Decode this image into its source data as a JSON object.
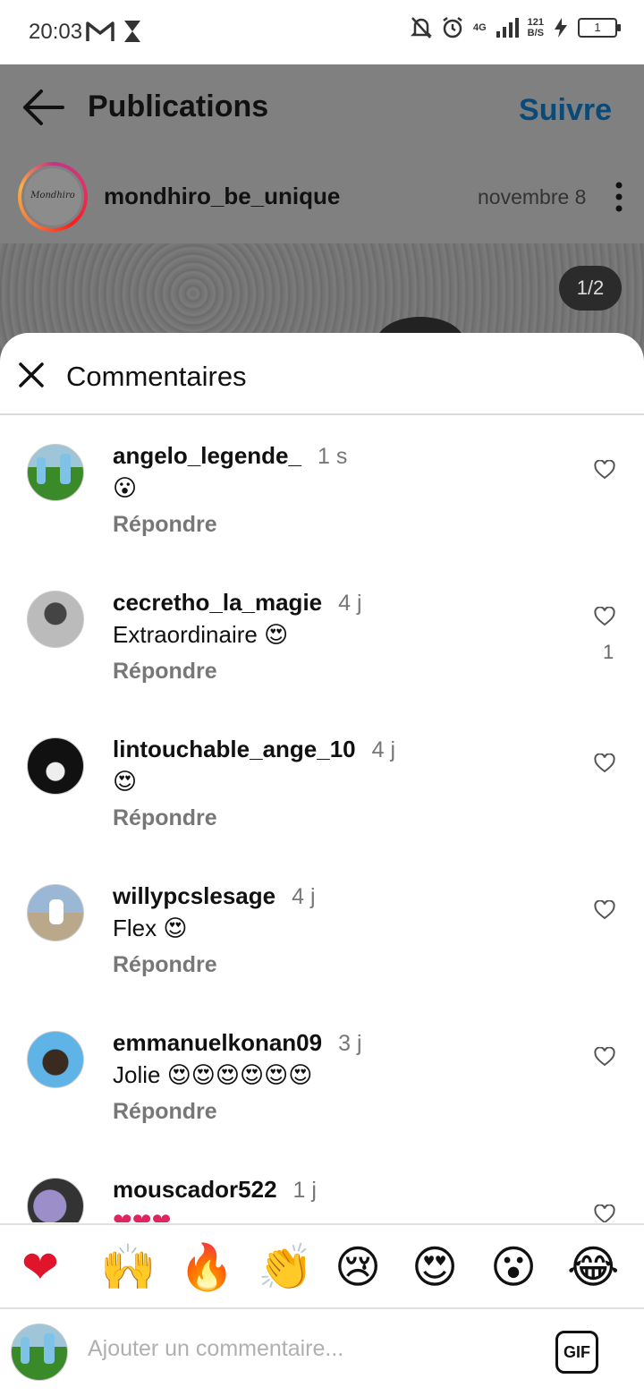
{
  "status_bar": {
    "time": "20:03",
    "network": "4G",
    "speed_top": "121",
    "speed_bottom": "B/S",
    "battery": "1"
  },
  "post": {
    "header_title": "Publications",
    "follow_label": "Suivre",
    "username": "mondhiro_be_unique",
    "avatar_text": "Mondhiro",
    "date": "novembre 8",
    "page_indicator": "1/2"
  },
  "comments_sheet": {
    "title": "Commentaires",
    "comments": [
      {
        "user": "angelo_legende_",
        "time": "1 s",
        "text": "😮",
        "reply": "Répondre",
        "likes": ""
      },
      {
        "user": "cecretho_la_magie",
        "time": "4 j",
        "text": "Extraordinaire 😍",
        "reply": "Répondre",
        "likes": "1"
      },
      {
        "user": "lintouchable_ange_10",
        "time": "4 j",
        "text": "😍",
        "reply": "Répondre",
        "likes": ""
      },
      {
        "user": "willypcslesage",
        "time": "4 j",
        "text": "Flex 😍",
        "reply": "Répondre",
        "likes": ""
      },
      {
        "user": "emmanuelkonan09",
        "time": "3 j",
        "text": "Jolie 😍😍😍😍😍😍",
        "reply": "Répondre",
        "likes": ""
      },
      {
        "user": "mouscador522",
        "time": "1 j",
        "text": "❤❤❤",
        "reply": "",
        "likes": ""
      }
    ],
    "quick_emojis": [
      "❤",
      "🙌",
      "🔥",
      "👏",
      "😢",
      "😍",
      "😮",
      "😂"
    ],
    "input_placeholder": "Ajouter un commentaire...",
    "gif_label": "GIF"
  },
  "colors": {
    "follow": "#0a4a78",
    "overlay": "#808080",
    "muted_text": "#777777"
  }
}
